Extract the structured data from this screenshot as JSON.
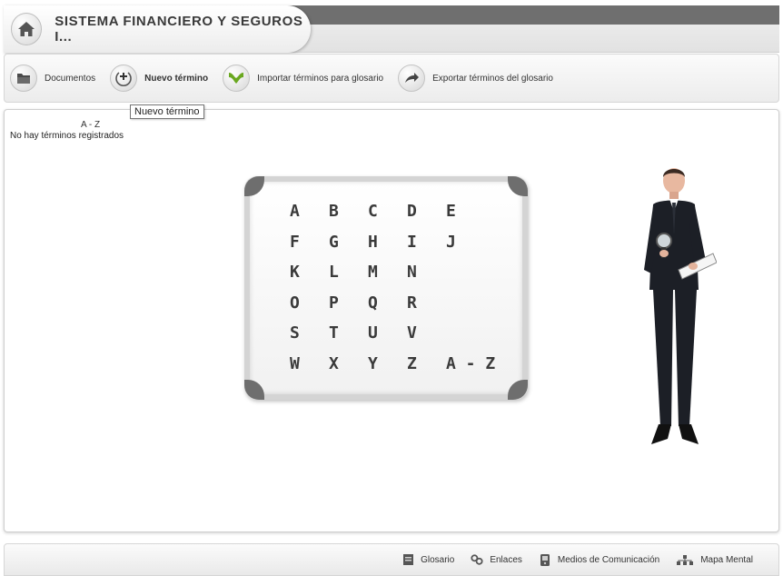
{
  "header": {
    "title": "SISTEMA FINANCIERO Y SEGUROS I..."
  },
  "toolbar": {
    "items": [
      {
        "label": "Documentos",
        "icon": "folder-icon"
      },
      {
        "label": "Nuevo término",
        "icon": "add-term-icon"
      },
      {
        "label": "Importar términos para glosario",
        "icon": "import-icon"
      },
      {
        "label": "Exportar términos del glosario",
        "icon": "export-icon"
      }
    ]
  },
  "tooltip": {
    "text": "Nuevo término"
  },
  "sidebar": {
    "heading": "A - Z",
    "empty_message": "No hay términos registrados"
  },
  "alphabet": {
    "rows": [
      [
        "A",
        "B",
        "C",
        "D",
        "E"
      ],
      [
        "F",
        "G",
        "H",
        "I",
        "J"
      ],
      [
        "K",
        "L",
        "M",
        "N"
      ],
      [
        "O",
        "P",
        "Q",
        "R"
      ],
      [
        "S",
        "T",
        "U",
        "V"
      ],
      [
        "W",
        "X",
        "Y",
        "Z",
        "A - Z"
      ]
    ]
  },
  "footer": {
    "items": [
      {
        "label": "Glosario",
        "icon": "glossary-icon"
      },
      {
        "label": "Enlaces",
        "icon": "links-icon"
      },
      {
        "label": "Medios de Comunicación",
        "icon": "media-icon"
      },
      {
        "label": "Mapa Mental",
        "icon": "mind-map-icon"
      }
    ]
  },
  "colors": {
    "header_strip": "#6f6f6f",
    "board_frame": "#d4d4d4",
    "board_corner": "#6e6e6e",
    "import_icon_green": "#6aa820"
  }
}
